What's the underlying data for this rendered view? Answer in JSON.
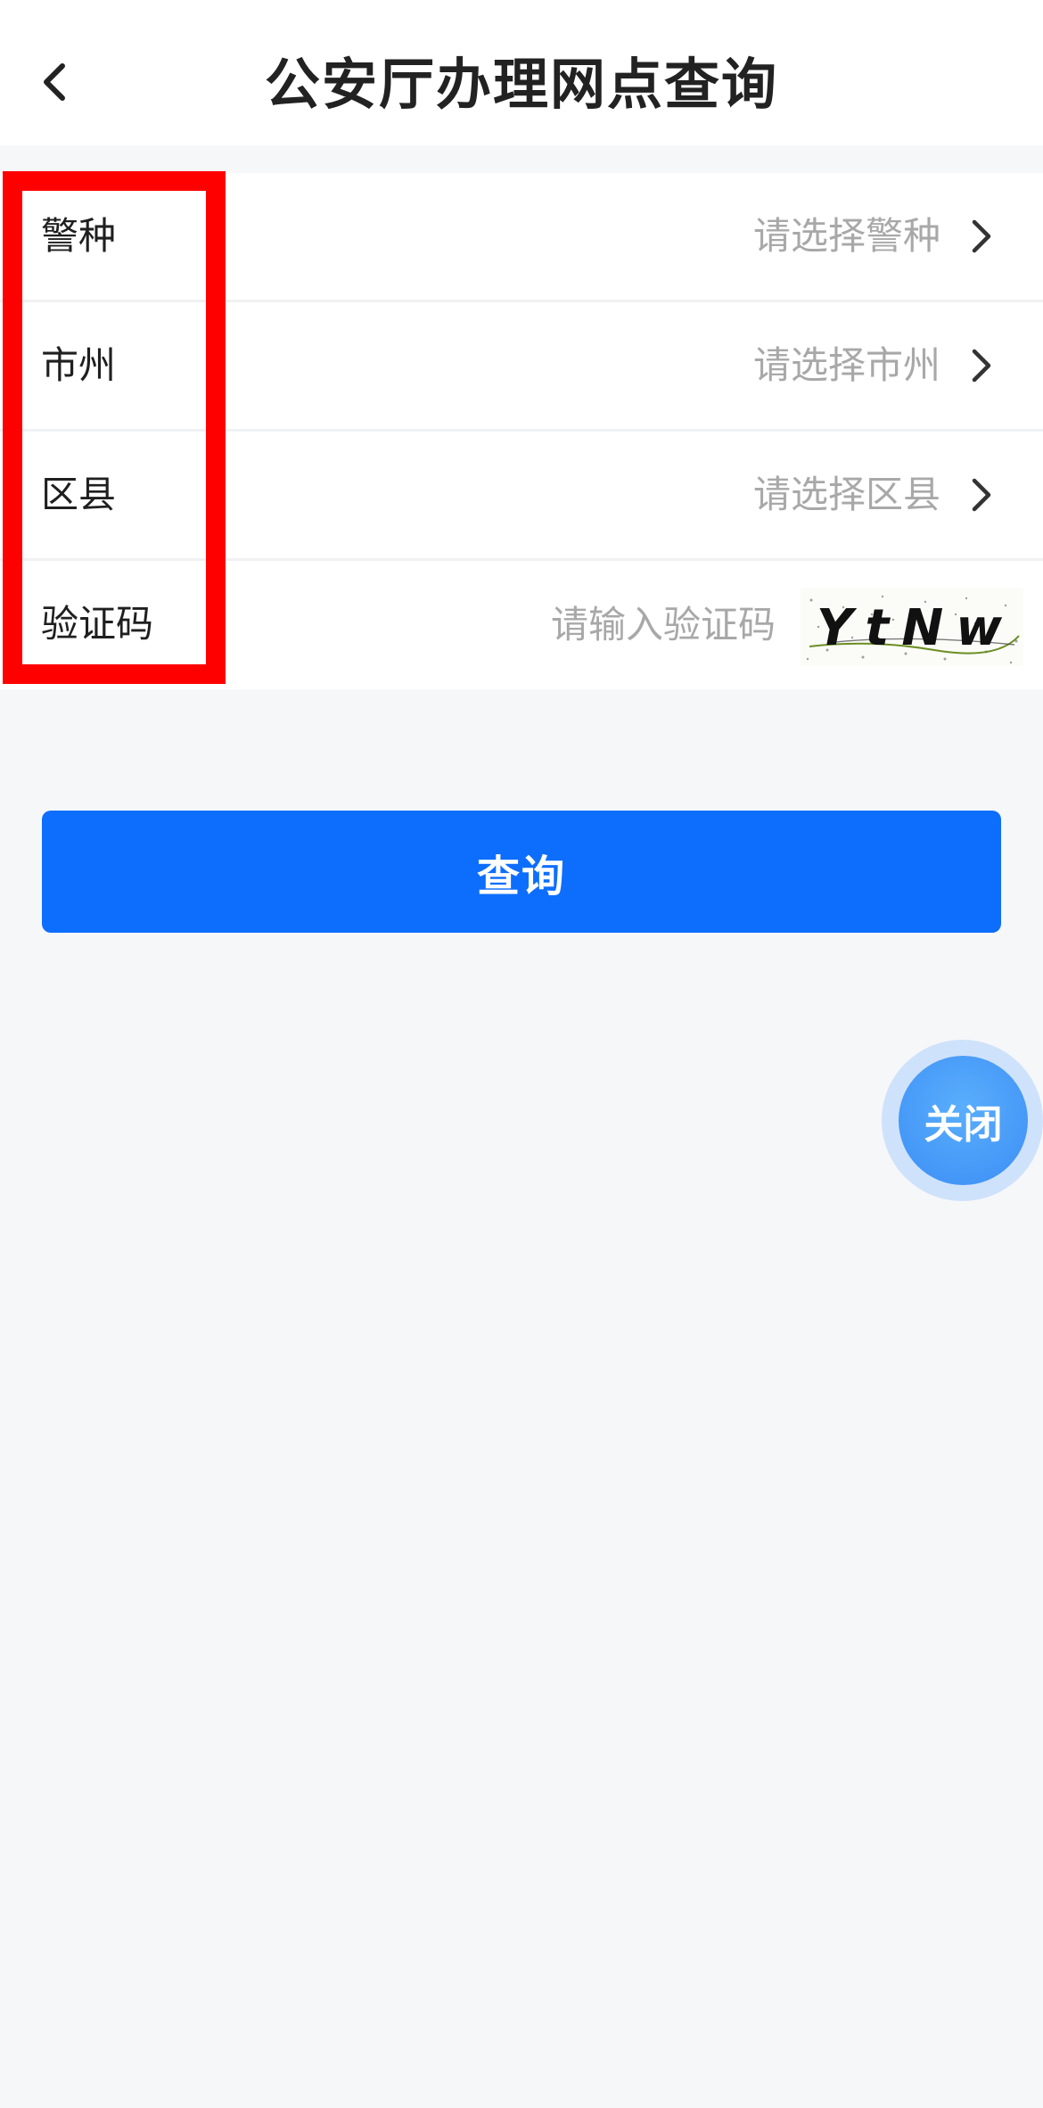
{
  "header": {
    "title": "公安厅办理网点查询",
    "back_icon": "chevron-left-icon"
  },
  "form": {
    "rows": [
      {
        "label": "警种",
        "value": "请选择警种"
      },
      {
        "label": "市州",
        "value": "请选择市州"
      },
      {
        "label": "区县",
        "value": "请选择区县"
      }
    ],
    "captcha": {
      "label": "验证码",
      "placeholder": "请输入验证码",
      "image_text": "YtNw"
    }
  },
  "query_button": {
    "label": "查询"
  },
  "float_close": {
    "label": "关闭"
  },
  "colors": {
    "primary": "#0d6efd",
    "highlight": "#ff0000",
    "float_button": "#3c8ef5"
  }
}
